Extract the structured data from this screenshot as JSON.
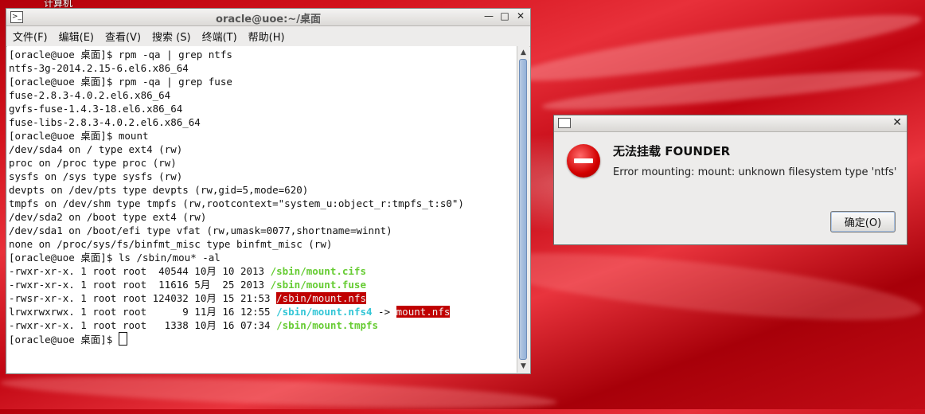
{
  "desktop": {
    "icon_label": "计算机"
  },
  "terminal": {
    "title": "oracle@uoe:~/桌面",
    "menu": [
      "文件(F)",
      "编辑(E)",
      "查看(V)",
      "搜索 (S)",
      "终端(T)",
      "帮助(H)"
    ],
    "lines": [
      "[oracle@uoe 桌面]$ rpm -qa | grep ntfs",
      "ntfs-3g-2014.2.15-6.el6.x86_64",
      "[oracle@uoe 桌面]$ rpm -qa | grep fuse",
      "fuse-2.8.3-4.0.2.el6.x86_64",
      "gvfs-fuse-1.4.3-18.el6.x86_64",
      "fuse-libs-2.8.3-4.0.2.el6.x86_64",
      "[oracle@uoe 桌面]$ mount",
      "/dev/sda4 on / type ext4 (rw)",
      "proc on /proc type proc (rw)",
      "sysfs on /sys type sysfs (rw)",
      "devpts on /dev/pts type devpts (rw,gid=5,mode=620)",
      "tmpfs on /dev/shm type tmpfs (rw,rootcontext=\"system_u:object_r:tmpfs_t:s0\")",
      "/dev/sda2 on /boot type ext4 (rw)",
      "/dev/sda1 on /boot/efi type vfat (rw,umask=0077,shortname=winnt)",
      "none on /proc/sys/fs/binfmt_misc type binfmt_misc (rw)",
      "[oracle@uoe 桌面]$ ls /sbin/mou* -al"
    ],
    "ls_rows": [
      {
        "meta": "-rwxr-xr-x. 1 root root  40544 10月 10 2013 ",
        "name": "/sbin/mount.cifs",
        "style": "green"
      },
      {
        "meta": "-rwxr-xr-x. 1 root root  11616 5月  25 2013 ",
        "name": "/sbin/mount.fuse",
        "style": "green"
      },
      {
        "meta": "-rwsr-xr-x. 1 root root 124032 10月 15 21:53 ",
        "name": "/sbin/mount.nfs",
        "style": "highlight"
      },
      {
        "meta": "lrwxrwxrwx. 1 root root      9 11月 16 12:55 ",
        "name": "/sbin/mount.nfs4",
        "style": "cyan",
        "arrow": " -> ",
        "target": "mount.nfs"
      },
      {
        "meta": "-rwxr-xr-x. 1 root root   1338 10月 16 07:34 ",
        "name": "/sbin/mount.tmpfs",
        "style": "green"
      }
    ],
    "prompt": "[oracle@uoe 桌面]$ "
  },
  "dialog": {
    "heading": "无法挂载 FOUNDER",
    "message": "Error mounting: mount: unknown filesystem type 'ntfs'",
    "ok_label": "确定(O)"
  },
  "colors": {
    "exec_green": "#66cc33",
    "link_cyan": "#33c6d6",
    "setuid_bg": "#c00000",
    "error_red": "#d20000"
  }
}
